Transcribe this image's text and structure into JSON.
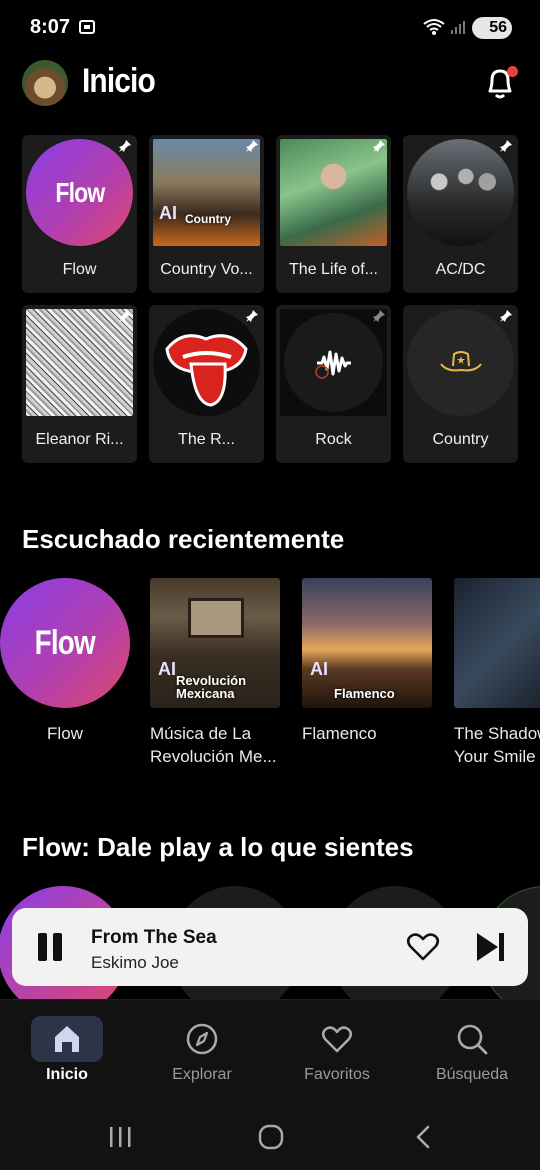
{
  "status_bar": {
    "time": "8:07",
    "battery": "56"
  },
  "header": {
    "title": "Inicio"
  },
  "pinned": [
    {
      "label": "Flow",
      "type": "flow",
      "art_text": "Flow"
    },
    {
      "label": "Country Vo...",
      "type": "photo",
      "ai_label": "AI",
      "ai_sub": "Country"
    },
    {
      "label": "The Life of...",
      "type": "photo"
    },
    {
      "label": "AC/DC",
      "type": "artist"
    },
    {
      "label": "Eleanor Ri...",
      "type": "photo"
    },
    {
      "label": "The R...",
      "type": "artist"
    },
    {
      "label": "Rock",
      "type": "genre"
    },
    {
      "label": "Country",
      "type": "genre"
    }
  ],
  "recent": {
    "title": "Escuchado recientemente",
    "items": [
      {
        "label": "Flow",
        "art_text": "Flow"
      },
      {
        "label": "Música de La Revolución Me...",
        "ai_label": "AI",
        "ai_sub": "Revolución Mexicana"
      },
      {
        "label": "Flamenco",
        "ai_label": "AI",
        "ai_sub": "Flamenco"
      },
      {
        "label": "The Shadow of Your Smile"
      }
    ]
  },
  "flow_section": {
    "title": "Flow: Dale play a lo que sientes"
  },
  "player": {
    "song": "From The Sea",
    "artist": "Eskimo Joe"
  },
  "nav": [
    {
      "label": "Inicio",
      "icon": "home-icon",
      "active": true
    },
    {
      "label": "Explorar",
      "icon": "compass-icon",
      "active": false
    },
    {
      "label": "Favoritos",
      "icon": "heart-icon",
      "active": false
    },
    {
      "label": "Búsqueda",
      "icon": "search-icon",
      "active": false
    }
  ],
  "colors": {
    "flow_gradient_start": "#8a3ee8",
    "flow_gradient_end": "#e0486a",
    "nav_active_bg": "#2e3448",
    "notification_dot": "#e8433a"
  }
}
